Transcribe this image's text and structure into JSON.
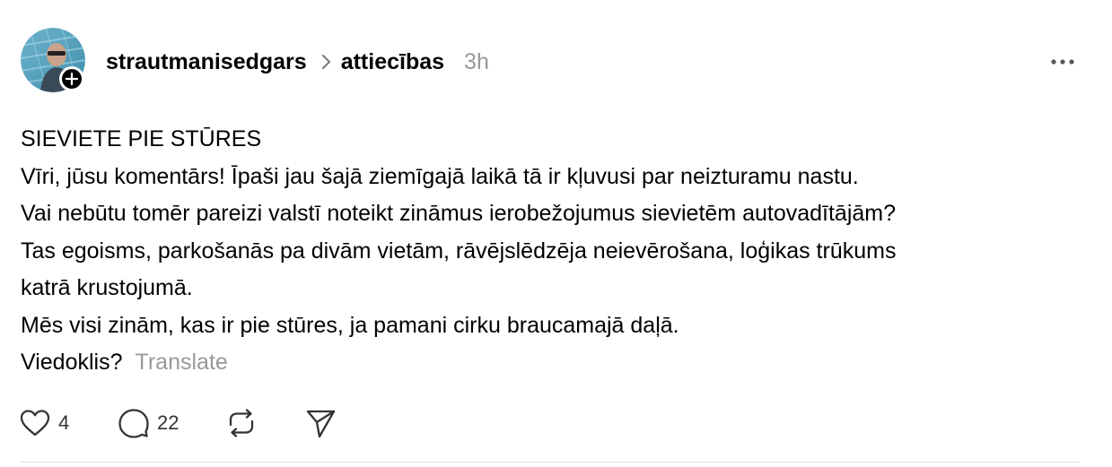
{
  "post": {
    "author": "strautmanisedgars",
    "community": "attiecības",
    "timestamp": "3h",
    "lines": [
      "SIEVIETE PIE STŪRES",
      "Vīri, jūsu komentārs! Īpaši jau šajā ziemīgajā laikā tā ir kļuvusi par neizturamu nastu.",
      "Vai nebūtu tomēr pareizi valstī noteikt zināmus ierobežojumus sievietēm autovadītājām?",
      "Tas egoisms, parkošanās pa divām vietām, rāvējslēdzēja neievērošana, loģikas trūkums",
      "katrā krustojumā.",
      "Mēs visi zinām, kas ir pie stūres, ja pamani cirku braucamajā daļā.",
      "Viedoklis?"
    ],
    "translate_label": "Translate"
  },
  "actions": {
    "likes": "4",
    "comments": "22"
  },
  "icons": {
    "avatar": "avatar-photo",
    "follow": "plus-icon",
    "chevron": "chevron-right-icon",
    "more": "more-horizontal-icon",
    "like": "heart-icon",
    "comment": "comment-bubble-icon",
    "repost": "repost-icon",
    "share": "send-icon"
  },
  "colors": {
    "text": "#000000",
    "muted": "#999999",
    "divider": "#dddddd"
  }
}
